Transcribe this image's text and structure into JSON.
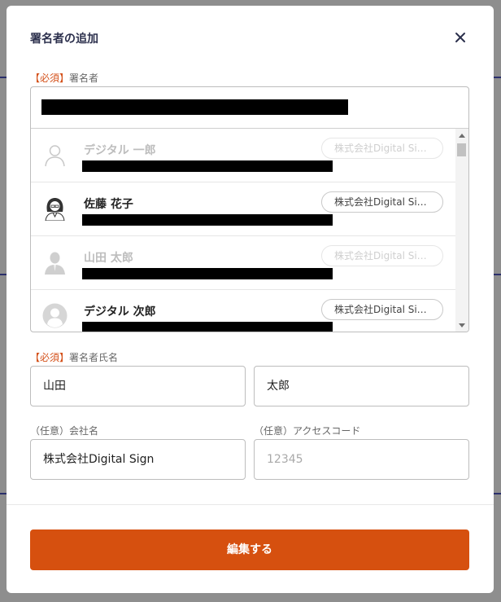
{
  "modal": {
    "title": "署名者の追加",
    "close_icon": "close-icon"
  },
  "signer_field": {
    "required_tag": "【必須】",
    "label": "署名者"
  },
  "signer_list": [
    {
      "name": "デジタル 一郎",
      "company": "株式会社Digital Si…",
      "state": "disabled",
      "avatar": "person-silhouette-icon"
    },
    {
      "name": "佐藤 花子",
      "company": "株式会社Digital Si…",
      "state": "enabled",
      "avatar": "woman-avatar-icon"
    },
    {
      "name": "山田 太郎",
      "company": "株式会社Digital Si…",
      "state": "disabled",
      "avatar": "man-silhouette-icon"
    },
    {
      "name": "デジタル 次郎",
      "company": "株式会社Digital Si…",
      "state": "enabled",
      "avatar": "default-user-icon"
    }
  ],
  "name_field": {
    "required_tag": "【必須】",
    "label": "署名者氏名",
    "last_name": "山田",
    "first_name": "太郎"
  },
  "company_field": {
    "optional_tag": "（任意）",
    "label": "会社名",
    "value": "株式会社Digital Sign"
  },
  "access_code_field": {
    "optional_tag": "（任意）",
    "label": "アクセスコード",
    "placeholder": "12345"
  },
  "submit_button": {
    "label": "編集する"
  },
  "colors": {
    "accent": "#d6500f",
    "title": "#2b2f4c"
  }
}
